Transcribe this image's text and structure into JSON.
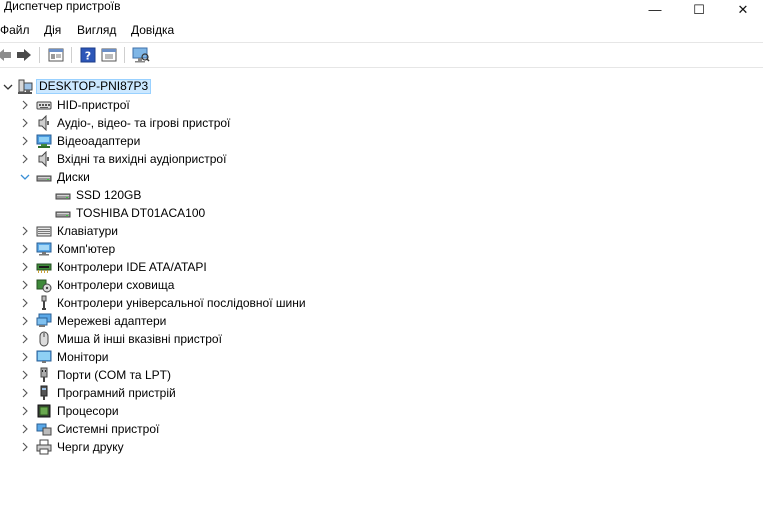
{
  "window": {
    "title": "Диспетчер пристроїв",
    "minimize_glyph": "—",
    "maximize_glyph": "☐",
    "close_glyph": "✕"
  },
  "menu": {
    "items": [
      "Файл",
      "Дія",
      "Вигляд",
      "Довідка"
    ]
  },
  "toolbar": {
    "icons": [
      "back-arrow-icon",
      "forward-arrow-icon",
      "properties-icon",
      "help-icon",
      "update-driver-icon",
      "scan-hardware-icon"
    ]
  },
  "tree": {
    "root": "DESKTOP-PNI87P3",
    "categories": [
      {
        "label": "HID-пристрої",
        "icon": "hid-icon",
        "expanded": false
      },
      {
        "label": "Аудіо-, відео- та ігрові пристрої",
        "icon": "speaker-icon",
        "expanded": false
      },
      {
        "label": "Відеоадаптери",
        "icon": "display-adapter-icon",
        "expanded": false
      },
      {
        "label": "Вхідні та вихідні аудіопристрої",
        "icon": "speaker-icon",
        "expanded": false
      },
      {
        "label": "Диски",
        "icon": "disk-drive-icon",
        "expanded": true
      },
      {
        "label": "Клавіатури",
        "icon": "keyboard-icon",
        "expanded": false
      },
      {
        "label": "Комп'ютер",
        "icon": "computer-icon",
        "expanded": false
      },
      {
        "label": "Контролери IDE ATA/ATAPI",
        "icon": "ide-controller-icon",
        "expanded": false
      },
      {
        "label": "Контролери сховища",
        "icon": "storage-controller-icon",
        "expanded": false
      },
      {
        "label": "Контролери універсальної послідовної шини",
        "icon": "usb-icon",
        "expanded": false
      },
      {
        "label": "Мережеві адаптери",
        "icon": "network-adapter-icon",
        "expanded": false
      },
      {
        "label": "Миша й інші вказівні пристрої",
        "icon": "mouse-icon",
        "expanded": false
      },
      {
        "label": "Монітори",
        "icon": "monitor-icon",
        "expanded": false
      },
      {
        "label": "Порти (COM та LPT)",
        "icon": "port-icon",
        "expanded": false
      },
      {
        "label": "Програмний пристрій",
        "icon": "software-device-icon",
        "expanded": false
      },
      {
        "label": "Процесори",
        "icon": "processor-icon",
        "expanded": false
      },
      {
        "label": "Системні пристрої",
        "icon": "system-device-icon",
        "expanded": false
      },
      {
        "label": "Черги друку",
        "icon": "printer-icon",
        "expanded": false
      }
    ],
    "disk_children": [
      "SSD 120GB",
      "TOSHIBA DT01ACA100"
    ]
  }
}
